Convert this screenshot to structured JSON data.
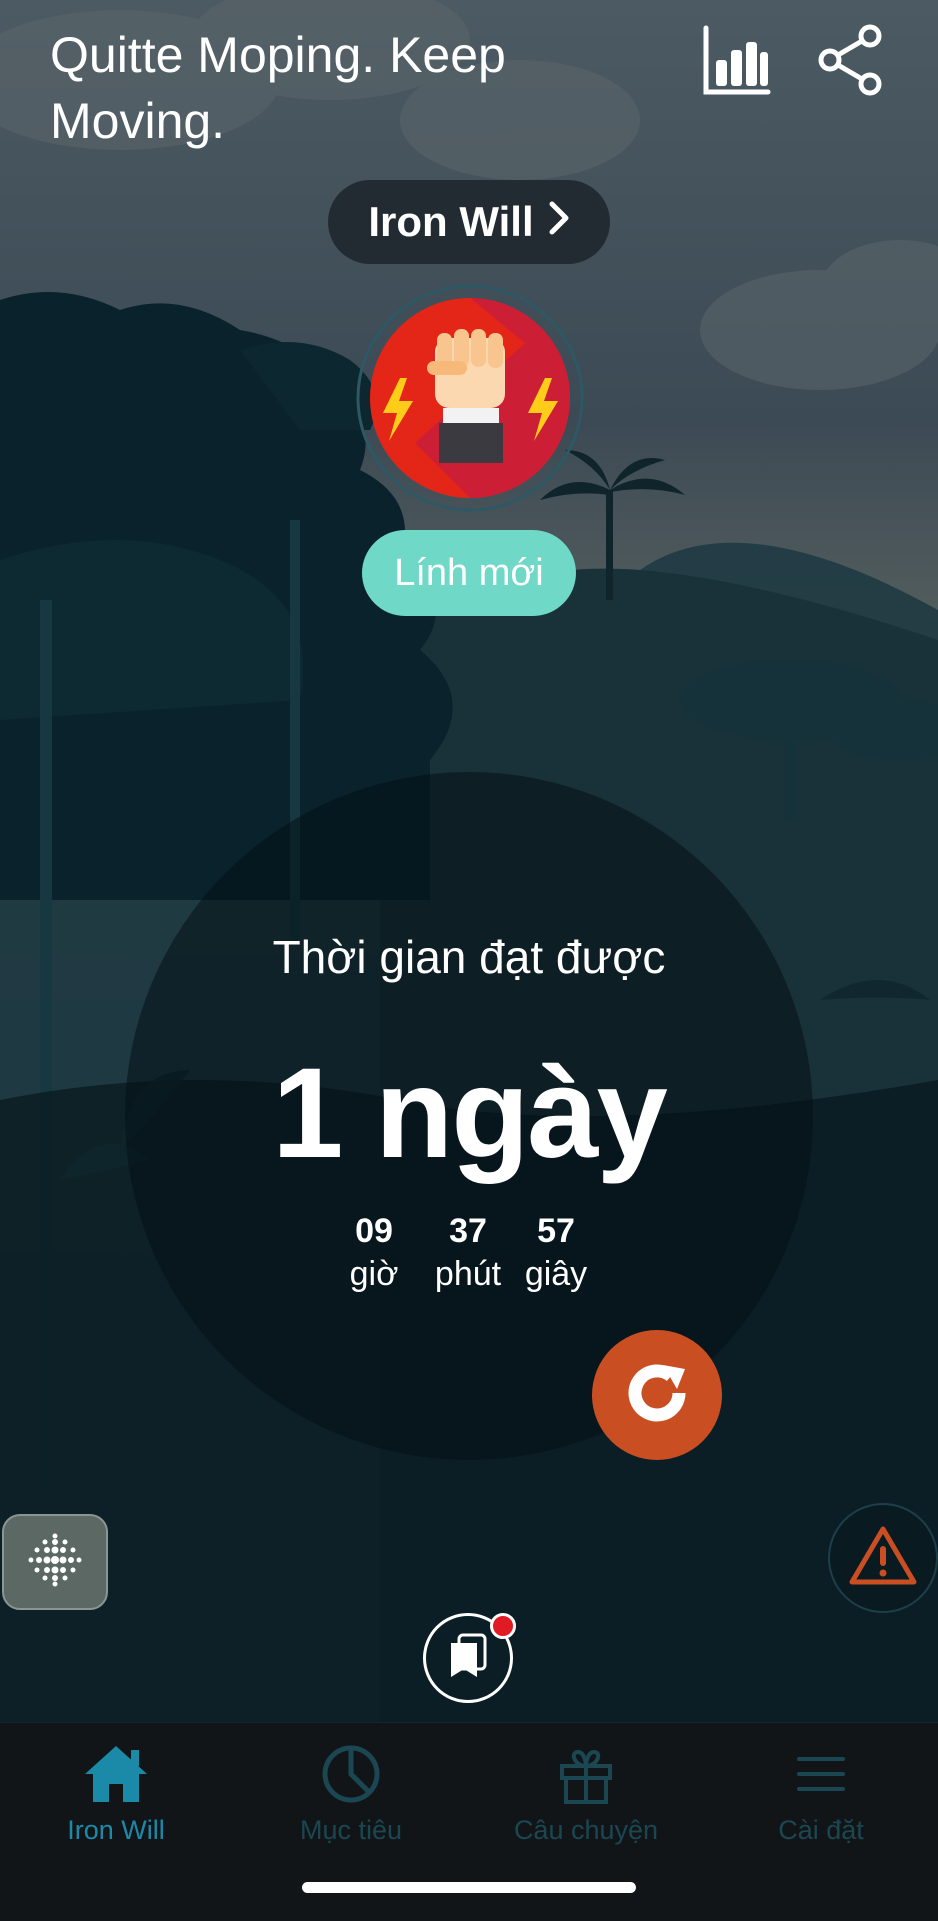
{
  "header": {
    "title": "Quitte Moping. Keep Moving.",
    "icons": [
      "stats-chart-icon",
      "share-icon"
    ]
  },
  "profile": {
    "name_label": "Iron Will",
    "badge_icon": "raised-fist-lightning-icon",
    "rank_label": "Lính mới"
  },
  "progress": {
    "label": "Thời gian đạt được",
    "days_text": "1 ngày",
    "hours": "09",
    "hours_unit": "giờ",
    "minutes": "37",
    "minutes_unit": "phút",
    "seconds": "57",
    "seconds_unit": "giây"
  },
  "actions": {
    "reset_icon": "refresh-icon",
    "breathing_icon": "dot-grid-icon",
    "warning_icon": "warning-triangle-icon",
    "library_icon": "bookmark-cards-icon"
  },
  "tabbar": {
    "tabs": [
      {
        "label": "Iron Will",
        "icon": "home-icon",
        "active": true
      },
      {
        "label": "Mục tiêu",
        "icon": "pie-chart-icon",
        "active": false
      },
      {
        "label": "Câu chuyện",
        "icon": "gift-icon",
        "active": false
      },
      {
        "label": "Cài đặt",
        "icon": "menu-icon",
        "active": false
      }
    ]
  },
  "colors": {
    "accent_active_tab": "#1b8aa8",
    "inactive_tab": "#1b4752",
    "rank_pill": "#6fd8c6",
    "reset_button": "#c94f22",
    "warning": "#c94f22",
    "notification_dot": "#e01b24"
  }
}
